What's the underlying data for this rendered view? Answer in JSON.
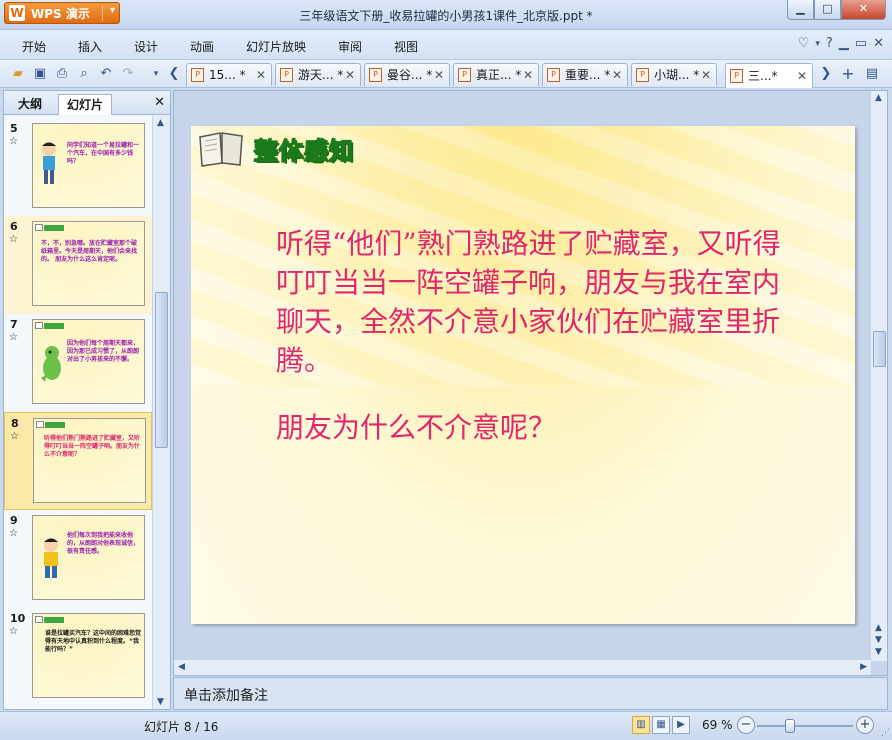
{
  "app": {
    "brand": "WPS 演示",
    "doc_title": "三年级语文下册_收易拉罐的小男孩1课件_北京版.ppt *"
  },
  "menu": [
    "开始",
    "插入",
    "设计",
    "动画",
    "幻灯片放映",
    "审阅",
    "视图"
  ],
  "tabs": [
    {
      "label": "15... *"
    },
    {
      "label": "游天... *"
    },
    {
      "label": "曼谷... *"
    },
    {
      "label": "真正... *"
    },
    {
      "label": "重要... *"
    },
    {
      "label": "小瑚... *"
    },
    {
      "label": "三...*"
    }
  ],
  "left_panel": {
    "tab_outline": "大纲",
    "tab_slides": "幻灯片",
    "thumbnails": [
      {
        "num": "5",
        "star": "☆",
        "text": "同学们知道一个易拉罐和一个汽车，在中国有多少钱吗？",
        "color": "#9b1fb3"
      },
      {
        "num": "6",
        "star": "☆",
        "text": "不，不，别急哪。放在贮藏室那个破纸箱里。今天是周期天，他们会来找的。  朋友为什么这么肯定呢。",
        "color": "#9b1fb3"
      },
      {
        "num": "7",
        "star": "☆",
        "text": "因为他们每个周期天都来，因为那已成习惯了，从朗朗对出了小男孩来的不懈。",
        "color": "#9b1fb3"
      },
      {
        "num": "8",
        "star": "☆",
        "text": "听得他们熟门熟路进了贮藏室，又听得叮叮当当一阵空罐子响。朋友为什么不介意呢？",
        "color": "#e0276c"
      },
      {
        "num": "9",
        "star": "☆",
        "text": "他们每次到我把能来收他的，从朗朗对他表现诚信，很有责任感。",
        "color": "#9b1fb3"
      },
      {
        "num": "10",
        "star": "☆",
        "text": "谁是拉罐买汽车？这中间的困难您觉得有天地中认真积到什么程度。“我能行吗？”",
        "color": "#1a1a1a"
      }
    ]
  },
  "slide": {
    "heading": "整体感知",
    "body": "听得“他们”熟门熟路进了贮藏室，又听得叮叮当当一阵空罐子响，朋友与我在室内聊天，全然不介意小家伙们在贮藏室里折腾。",
    "question": "朋友为什么不介意呢？"
  },
  "notes_placeholder": "单击添加备注",
  "status": {
    "slide_counter": "幻灯片 8 / 16",
    "zoom": "69 %",
    "zoom_level_percent": 69
  },
  "colors": {
    "accent_orange": "#e06c12",
    "slide_text": "#e0276c",
    "heading_green": "#1b7a1b",
    "heading_yellow": "#f4e640"
  }
}
